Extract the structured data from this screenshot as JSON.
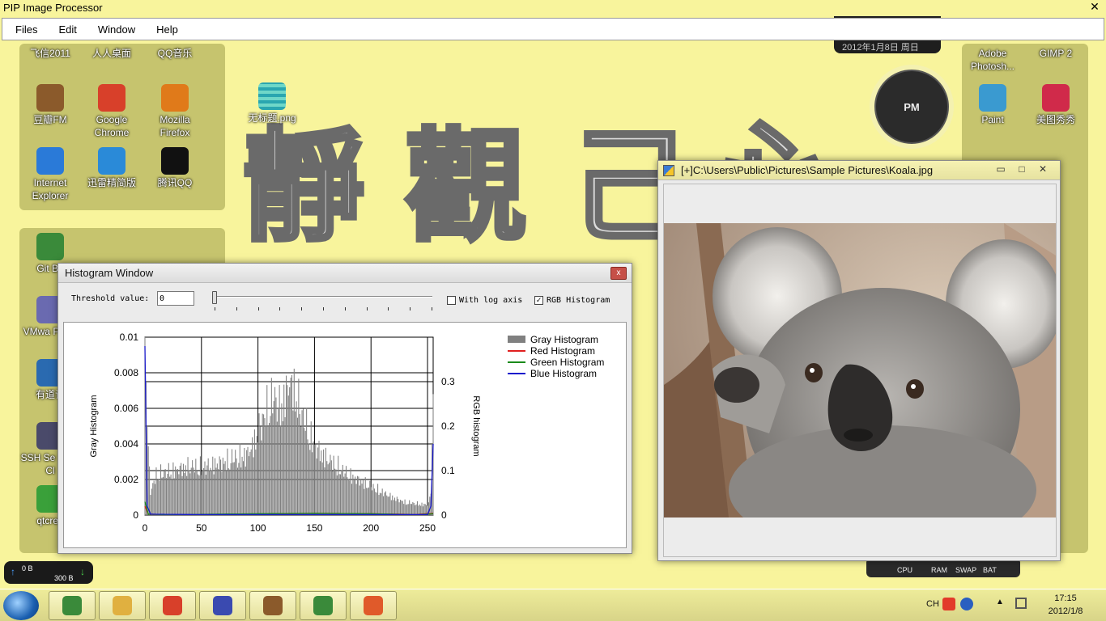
{
  "app": {
    "title": "PIP Image Processor",
    "close_glyph": "✕",
    "menu": [
      "Files",
      "Edit",
      "Window",
      "Help"
    ]
  },
  "desktop": {
    "icons_left": [
      {
        "label": "飞信2011",
        "icon": "fetion-icon"
      },
      {
        "label": "人人桌面",
        "icon": "renren-icon"
      },
      {
        "label": "QQ音乐",
        "icon": "qqmusic-icon"
      },
      {
        "label": "豆瓣FM",
        "icon": "doubanfm-icon"
      },
      {
        "label": "Google Chrome",
        "icon": "chrome-icon"
      },
      {
        "label": "Mozilla Firefox",
        "icon": "firefox-icon"
      },
      {
        "label": "Internet Explorer",
        "icon": "ie-icon"
      },
      {
        "label": "迅雷精简版",
        "icon": "xunlei-icon"
      },
      {
        "label": "腾讯QQ",
        "icon": "qq-icon"
      },
      {
        "label": "Git Ba",
        "icon": "git-icon"
      },
      {
        "label": "VMwa Playe",
        "icon": "vmware-icon"
      },
      {
        "label": "有道词",
        "icon": "youdao-icon"
      },
      {
        "label": "SSH Se Shell Cl",
        "icon": "ssh-icon"
      },
      {
        "label": "qtcrea",
        "icon": "qtcreator-icon"
      }
    ],
    "icons_right": [
      {
        "label": "Adobe Photosh...",
        "icon": "photoshop-icon"
      },
      {
        "label": "GIMP 2",
        "icon": "gimp-icon"
      },
      {
        "label": "Paint",
        "icon": "paint-icon"
      },
      {
        "label": "美图秀秀",
        "icon": "meitu-icon"
      }
    ],
    "file_icon": {
      "label": "无标题.png",
      "icon": "png-file-icon"
    },
    "calligraphy": [
      "靜",
      "觀",
      "己",
      "心"
    ],
    "clock_gadget": {
      "label": "PM"
    },
    "date_text": "2012年1月8日 周日",
    "meter_labels": [
      "CPU",
      "RAM",
      "SWAP",
      "BAT"
    ],
    "net": {
      "up": "0 B",
      "down": "300 B"
    }
  },
  "histogram_window": {
    "title": "Histogram Window",
    "close_glyph": "x",
    "threshold_label": "Threshold value:",
    "threshold_value": "0",
    "log_axis_label": "With log axis",
    "log_axis_checked": false,
    "rgb_label": "RGB Histogram",
    "rgb_checked": true,
    "check_glyph": "✓"
  },
  "chart_data": {
    "type": "bar",
    "xlim": [
      0,
      255
    ],
    "ylim_left": [
      0,
      0.01
    ],
    "ylim_right": [
      0,
      0.4
    ],
    "ylabel_left": "Gray Histogram",
    "ylabel_right": "RGB histogram",
    "xticks": [
      0,
      50,
      100,
      150,
      200,
      250
    ],
    "yticks_left": [
      "0",
      "0.002",
      "0.004",
      "0.006",
      "0.008",
      "0.01"
    ],
    "yticks_right": [
      "0",
      "0.1",
      "0.2",
      "0.3"
    ],
    "legend_position": "right",
    "series": [
      {
        "name": "Gray Histogram",
        "color": "#808080",
        "kind": "bar",
        "anchors": [
          [
            0,
            0.01
          ],
          [
            2,
            0.005
          ],
          [
            5,
            0.0016
          ],
          [
            10,
            0.0028
          ],
          [
            20,
            0.003
          ],
          [
            30,
            0.0032
          ],
          [
            40,
            0.0034
          ],
          [
            50,
            0.0033
          ],
          [
            60,
            0.0035
          ],
          [
            70,
            0.0037
          ],
          [
            80,
            0.004
          ],
          [
            90,
            0.0042
          ],
          [
            95,
            0.0048
          ],
          [
            100,
            0.0058
          ],
          [
            105,
            0.0068
          ],
          [
            110,
            0.0078
          ],
          [
            115,
            0.0082
          ],
          [
            120,
            0.0074
          ],
          [
            125,
            0.0086
          ],
          [
            128,
            0.0092
          ],
          [
            132,
            0.0088
          ],
          [
            140,
            0.0068
          ],
          [
            150,
            0.0048
          ],
          [
            160,
            0.004
          ],
          [
            170,
            0.0034
          ],
          [
            180,
            0.0028
          ],
          [
            190,
            0.0024
          ],
          [
            200,
            0.002
          ],
          [
            210,
            0.0016
          ],
          [
            220,
            0.0012
          ],
          [
            230,
            0.0009
          ],
          [
            240,
            0.0008
          ],
          [
            250,
            0.0007
          ],
          [
            253,
            0.0012
          ],
          [
            255,
            0.0068
          ]
        ]
      },
      {
        "name": "Red Histogram",
        "color": "#e02020",
        "kind": "line",
        "anchors": [
          [
            0,
            0.02
          ],
          [
            3,
            0.002
          ],
          [
            20,
            0.001
          ],
          [
            100,
            0.002
          ],
          [
            150,
            0.004
          ],
          [
            200,
            0.003
          ],
          [
            240,
            0.0015
          ],
          [
            255,
            0.004
          ]
        ]
      },
      {
        "name": "Green Histogram",
        "color": "#1a8a1a",
        "kind": "line",
        "anchors": [
          [
            0,
            0.03
          ],
          [
            3,
            0.002
          ],
          [
            20,
            0.001
          ],
          [
            100,
            0.003
          ],
          [
            150,
            0.004
          ],
          [
            200,
            0.003
          ],
          [
            240,
            0.001
          ],
          [
            255,
            0.003
          ]
        ]
      },
      {
        "name": "Blue Histogram",
        "color": "#1a1acc",
        "kind": "line",
        "anchors": [
          [
            0,
            0.38
          ],
          [
            2,
            0.02
          ],
          [
            5,
            0.002
          ],
          [
            50,
            0.001
          ],
          [
            150,
            0.001
          ],
          [
            250,
            0.001
          ],
          [
            253,
            0.02
          ],
          [
            255,
            0.16
          ]
        ]
      }
    ]
  },
  "image_window": {
    "title": "[+]C:\\Users\\Public\\Pictures\\Sample Pictures\\Koala.jpg",
    "buttons": [
      "▭",
      "□",
      "✕"
    ]
  },
  "taskbar": {
    "apps": [
      "activity-monitor-icon",
      "explorer-icon",
      "chrome-icon",
      "visual-studio-icon",
      "doubanfm-icon",
      "gitgui-icon",
      "pip-app-icon"
    ],
    "ime": "CH",
    "time": "17:15",
    "date": "2012/1/8"
  }
}
